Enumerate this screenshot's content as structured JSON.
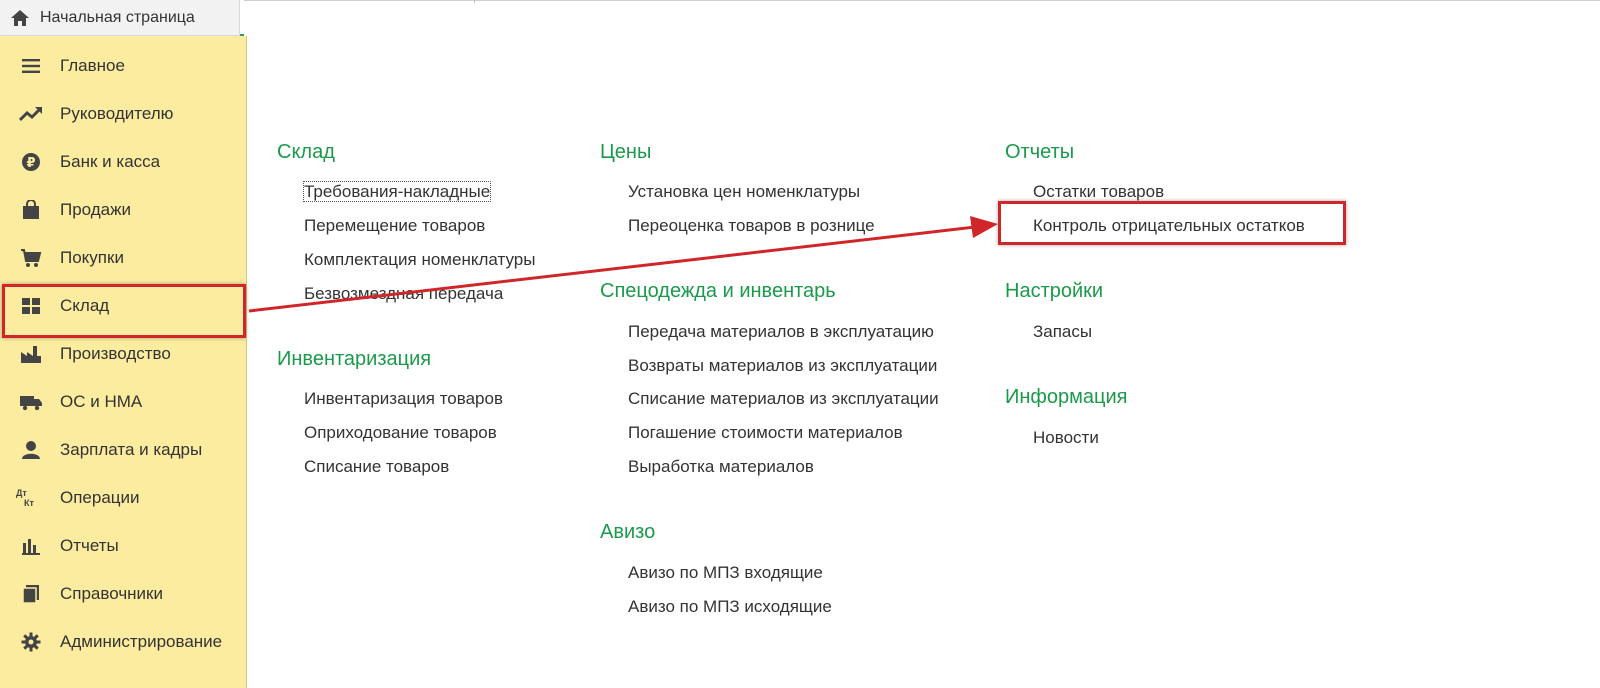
{
  "home_tab": {
    "label": "Начальная страница",
    "icon": "home-icon"
  },
  "sidebar": {
    "items": [
      {
        "label": "Главное",
        "icon": "menu-lines-icon"
      },
      {
        "label": "Руководителю",
        "icon": "trend-up-icon"
      },
      {
        "label": "Банк и касса",
        "icon": "ruble-coin-icon"
      },
      {
        "label": "Продажи",
        "icon": "shopping-bag-icon"
      },
      {
        "label": "Покупки",
        "icon": "cart-icon"
      },
      {
        "label": "Склад",
        "icon": "warehouse-grid-icon",
        "active": true
      },
      {
        "label": "Производство",
        "icon": "factory-icon"
      },
      {
        "label": "ОС и НМА",
        "icon": "truck-icon"
      },
      {
        "label": "Зарплата и кадры",
        "icon": "person-icon"
      },
      {
        "label": "Операции",
        "icon": "dt-kt-icon"
      },
      {
        "label": "Отчеты",
        "icon": "bar-chart-icon"
      },
      {
        "label": "Справочники",
        "icon": "books-icon"
      },
      {
        "label": "Администрирование",
        "icon": "gear-icon"
      }
    ]
  },
  "dt_kt": {
    "top": "Дт",
    "bottom": "Кт"
  },
  "sections": {
    "sklad": {
      "title": "Склад",
      "links": [
        "Требования-накладные",
        "Перемещение товаров",
        "Комплектация номенклатуры",
        "Безвозмездная передача"
      ]
    },
    "inventarizaciya": {
      "title": "Инвентаризация",
      "links": [
        "Инвентаризация товаров",
        "Оприходование товаров",
        "Списание товаров"
      ]
    },
    "ceny": {
      "title": "Цены",
      "links": [
        "Установка цен номенклатуры",
        "Переоценка товаров в рознице"
      ]
    },
    "specodezhda": {
      "title": "Спецодежда и инвентарь",
      "links": [
        "Передача материалов в эксплуатацию",
        "Возвраты материалов из эксплуатации",
        "Списание материалов из эксплуатации",
        "Погашение стоимости материалов",
        "Выработка материалов"
      ]
    },
    "avizo": {
      "title": "Авизо",
      "links": [
        "Авизо по МПЗ входящие",
        "Авизо по МПЗ исходящие"
      ]
    },
    "otchety": {
      "title": "Отчеты",
      "links": [
        "Остатки товаров",
        "Контроль отрицательных остатков"
      ]
    },
    "nastroyki": {
      "title": "Настройки",
      "links": [
        "Запасы"
      ]
    },
    "informaciya": {
      "title": "Информация",
      "links": [
        "Новости"
      ]
    }
  },
  "colors": {
    "sidebar_bg": "#fbeca0",
    "section_title": "#1a9a4a",
    "highlight": "#d0262a"
  }
}
